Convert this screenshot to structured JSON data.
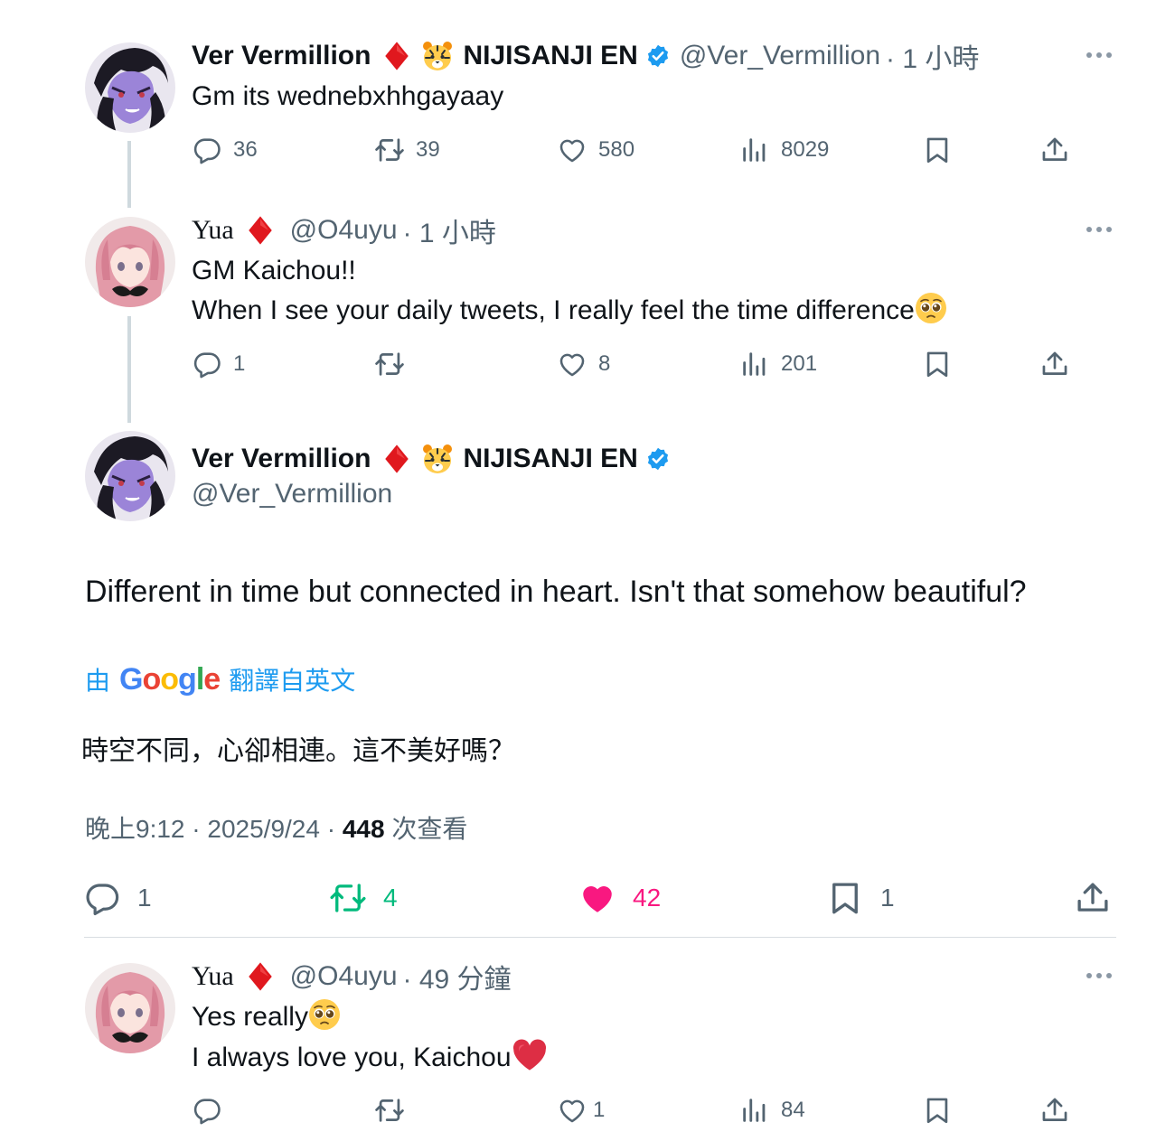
{
  "tweets": [
    {
      "name": "Ver Vermillion",
      "org": "NIJISANJI EN",
      "handle": "@Ver_Vermillion",
      "time": "· 1 小時",
      "text": "Gm its wednebxhhgayaay",
      "reply": "36",
      "retweet": "39",
      "like": "580",
      "views": "8029"
    },
    {
      "name": "Yua",
      "handle": "@O4uyu",
      "time": "· 1 小時",
      "line1": "GM Kaichou!!",
      "line2": "When I see your daily tweets, I really feel the time difference",
      "reply": "1",
      "like": "8",
      "views": "201"
    }
  ],
  "main": {
    "name": "Ver Vermillion",
    "org": "NIJISANJI EN",
    "handle": "@Ver_Vermillion",
    "text": "Different in time but connected in heart. Isn't that somehow beautiful?",
    "translate_prefix": "由",
    "translate_brand": "Google",
    "translate_suffix": "翻譯自英文",
    "translated_text": "時空不同，心卻相連。這不美好嗎？",
    "time": "晚上9:12 · 2025/9/24 · ",
    "views_count": "448",
    "views_label": " 次查看",
    "reply": "1",
    "retweet": "4",
    "like": "42",
    "bookmark": "1",
    "colors": {
      "retweet": "#00ba7c",
      "like": "#f91880",
      "link": "#1d9bf0"
    }
  },
  "reply": {
    "name": "Yua",
    "handle": "@O4uyu",
    "time": "· 49 分鐘",
    "line1": "Yes really",
    "line2": "I always love you, Kaichou",
    "like": "1",
    "views": "84"
  }
}
